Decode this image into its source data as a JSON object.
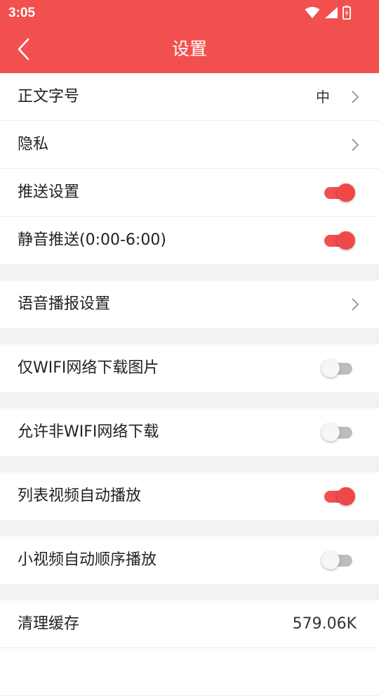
{
  "status_bar": {
    "time": "3:05"
  },
  "header": {
    "title": "设置"
  },
  "colors": {
    "accent": "#f24f4f",
    "toggle_on": "#f25050",
    "toggle_off": "#bdbdbd"
  },
  "settings": {
    "font_size": {
      "label": "正文字号",
      "value": "中"
    },
    "privacy": {
      "label": "隐私"
    },
    "push": {
      "label": "推送设置",
      "on": true
    },
    "mute_push": {
      "label": "静音推送(0:00-6:00)",
      "on": true
    },
    "voice_broadcast": {
      "label": "语音播报设置"
    },
    "wifi_images": {
      "label": "仅WIFI网络下载图片",
      "on": false
    },
    "non_wifi_download": {
      "label": "允许非WIFI网络下载",
      "on": false
    },
    "list_video_autoplay": {
      "label": "列表视频自动播放",
      "on": true
    },
    "short_video_sequence": {
      "label": "小视频自动顺序播放",
      "on": false
    },
    "clear_cache": {
      "label": "清理缓存",
      "value": "579.06K"
    }
  }
}
